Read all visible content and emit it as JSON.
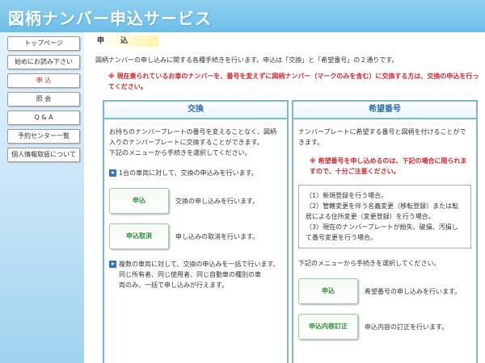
{
  "header": {
    "title": "図柄ナンバー申込サービス"
  },
  "sidebar": {
    "items": [
      {
        "label": "トップページ"
      },
      {
        "label": "始めにお読み下さい"
      },
      {
        "label": "申 込"
      },
      {
        "label": "照 会"
      },
      {
        "label": "Q & A"
      },
      {
        "label": "予約センター一覧"
      },
      {
        "label": "個人情報取扱について"
      }
    ]
  },
  "main": {
    "heading": "申込",
    "intro": "図柄ナンバーの申し込みに関する各種手続きを行います。申込は「交換」と「希望番号」の２通りです。",
    "warning": "※ 現在乗られているお車のナンバーを、番号を変えずに図柄ナンバー（マークのみを含む）に交換する方は、交換の申込を行ってください。"
  },
  "exchange": {
    "title": "交換",
    "desc": "お持ちのナンバープレートの番号を変えることなく、図柄入りのナンバープレートに交換することができます。",
    "select_note": "下記のメニューから手続きを選択してください。",
    "single_label": "1台の車両に対して、交換の申込みを行います。",
    "apply_btn": "申込",
    "apply_desc": "交換の申し込みを行います。",
    "cancel_btn": "申込取消",
    "cancel_desc": "申し込みの取消を行います。",
    "multi_label": "複数の車両に対して、交換の申込みを一括で行います。",
    "multi_note1": "同じ所有者、同じ使用者、同じ自動車の種別の車",
    "multi_note2": "両のみ、一括で申し込みが行えます。"
  },
  "wish": {
    "title": "希望番号",
    "desc": "ナンバープレートに希望する番号と図柄を付けることができます。",
    "note": "※ 希望番号を申し込めるのは、下記の場合に限られますので、十分ご注意ください。",
    "list": [
      "（1）新規登録を行う場合。",
      "（2）管轄変更を伴う名義変更（移転登録）または転居による住所変更（変更登録）を行う場合。",
      "（3）現在のナンバープレートが紛失、破損、汚損して番号変更を行う場合。"
    ],
    "select_note": "下記のメニューから手続きを選択してください。",
    "apply_btn": "申込",
    "apply_desc": "希望番号の申し込みを行います。",
    "revise_btn": "申込内容訂正",
    "revise_desc": "申込内容の訂正を行います。"
  }
}
